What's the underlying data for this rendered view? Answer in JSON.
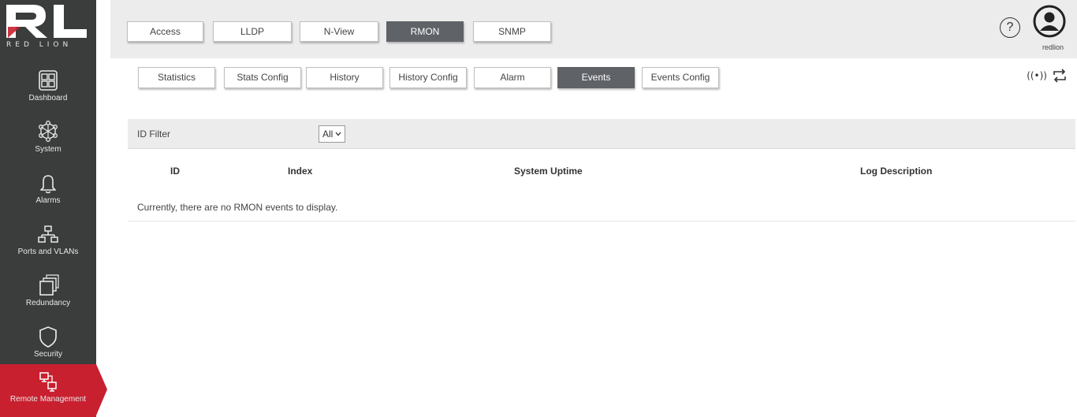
{
  "brand": {
    "logo_text": "RED LION",
    "accent_color": "#c8202f",
    "sidebar_color": "#3a3d3c"
  },
  "sidebar": {
    "items": [
      {
        "label": "Dashboard",
        "icon": "dashboard-icon"
      },
      {
        "label": "System",
        "icon": "system-network-icon"
      },
      {
        "label": "Alarms",
        "icon": "bell-icon"
      },
      {
        "label": "Ports and VLANs",
        "icon": "ports-topology-icon"
      },
      {
        "label": "Redundancy",
        "icon": "stacked-windows-icon"
      },
      {
        "label": "Security",
        "icon": "shield-icon"
      },
      {
        "label": "Remote Management",
        "icon": "remote-management-icon",
        "active": true
      }
    ]
  },
  "top_tabs": [
    {
      "label": "Access"
    },
    {
      "label": "LLDP"
    },
    {
      "label": "N-View"
    },
    {
      "label": "RMON",
      "active": true
    },
    {
      "label": "SNMP"
    }
  ],
  "sub_tabs": [
    {
      "label": "Statistics"
    },
    {
      "label": "Stats Config"
    },
    {
      "label": "History"
    },
    {
      "label": "History Config"
    },
    {
      "label": "Alarm"
    },
    {
      "label": "Events",
      "active": true
    },
    {
      "label": "Events Config"
    }
  ],
  "header": {
    "help_symbol": "?",
    "user_name": "redlion"
  },
  "toolbar": {
    "live_symbol": "((•))",
    "sync_icon": "sync-arrows-icon"
  },
  "filter": {
    "label": "ID Filter",
    "selected": "All"
  },
  "table": {
    "columns": [
      "ID",
      "Index",
      "System Uptime",
      "Log Description"
    ],
    "empty_message": "Currently, there are no RMON events to display."
  }
}
